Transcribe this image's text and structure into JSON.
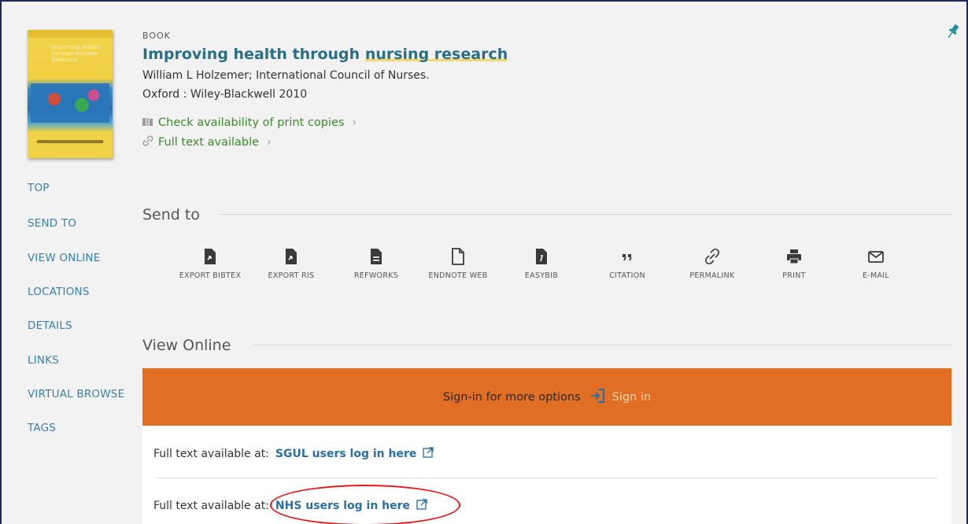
{
  "record": {
    "type": "BOOK",
    "title_part1": "Improving health through ",
    "title_highlight": "nursing research",
    "authors": "William L Holzemer; International Council of Nurses.",
    "publication": "Oxford : Wiley-Blackwell 2010",
    "print_copies_label": "Check availability of print copies",
    "full_text_label": "Full text available",
    "cover_title": "Improving Health through Nursing Research",
    "cover_icons": {
      "print": "book-icon",
      "full_text": "link-icon",
      "pin": "pin-icon"
    }
  },
  "nav": [
    {
      "label": "TOP"
    },
    {
      "label": "SEND TO"
    },
    {
      "label": "VIEW ONLINE"
    },
    {
      "label": "LOCATIONS"
    },
    {
      "label": "DETAILS"
    },
    {
      "label": "LINKS"
    },
    {
      "label": "VIRTUAL BROWSE"
    },
    {
      "label": "TAGS"
    }
  ],
  "send_to": {
    "heading": "Send to",
    "actions": [
      {
        "label": "EXPORT BIBTEX",
        "icon": "export-bibtex-icon"
      },
      {
        "label": "EXPORT RIS",
        "icon": "export-ris-icon"
      },
      {
        "label": "REFWORKS",
        "icon": "document-icon"
      },
      {
        "label": "ENDNOTE WEB",
        "icon": "page-icon"
      },
      {
        "label": "EASYBIB",
        "icon": "easybib-icon"
      },
      {
        "label": "CITATION",
        "icon": "quote-icon"
      },
      {
        "label": "PERMALINK",
        "icon": "link-icon"
      },
      {
        "label": "PRINT",
        "icon": "printer-icon"
      },
      {
        "label": "E-MAIL",
        "icon": "envelope-icon"
      }
    ]
  },
  "view_online": {
    "heading": "View Online",
    "signin_text": "Sign-in for more options",
    "signin_link": "Sign in",
    "prefix": "Full text available at:",
    "links": [
      {
        "label": "SGUL users log in here"
      },
      {
        "label": "NHS users log in here"
      }
    ]
  },
  "colors": {
    "accent_orange": "#e06e25",
    "link_blue": "#2a6fa8",
    "green": "#3c8a2d",
    "annotation_red": "#e41b1b"
  }
}
